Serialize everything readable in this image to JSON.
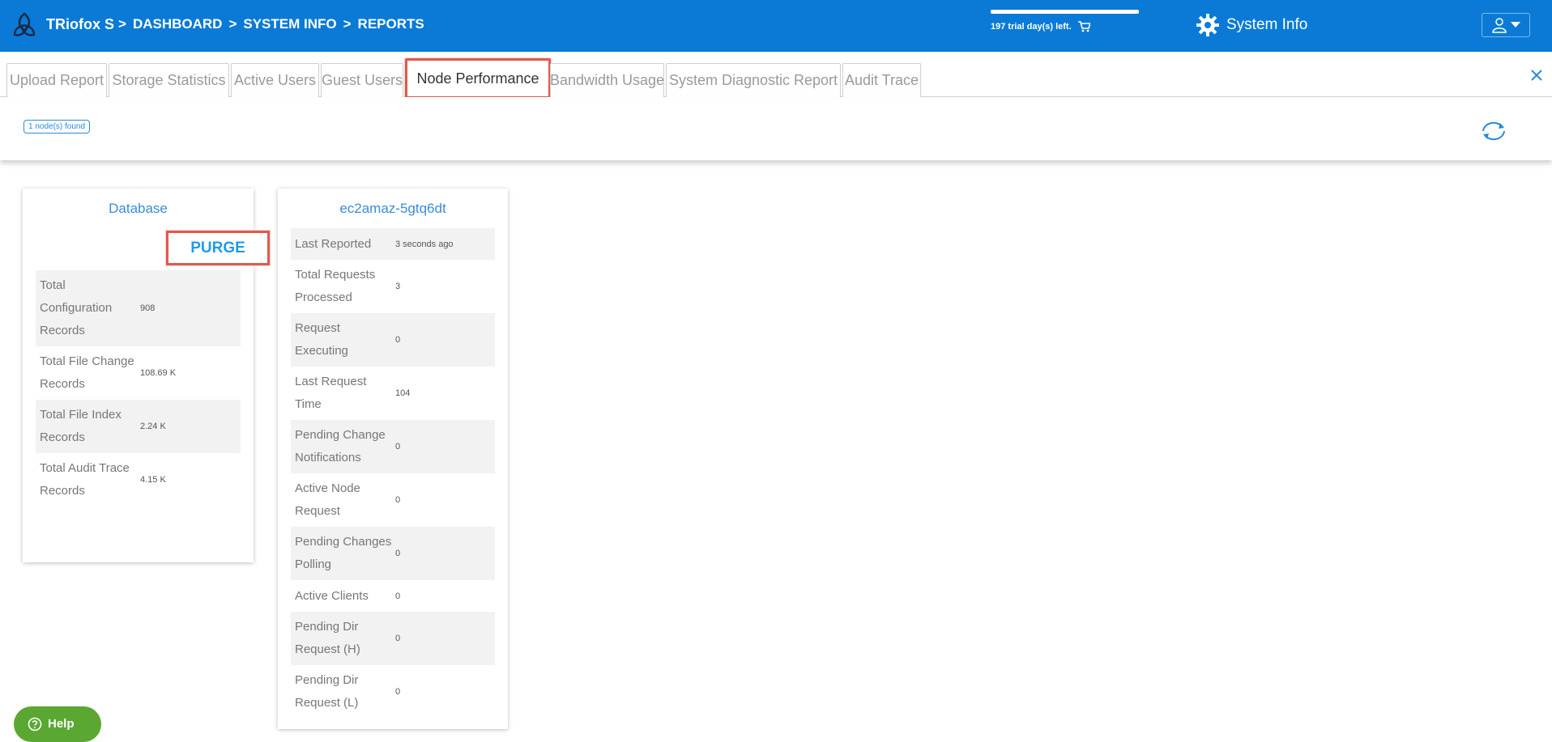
{
  "header": {
    "app_name": "TRiofox S",
    "breadcrumb": [
      ">",
      "DASHBOARD",
      ">",
      "SYSTEM INFO",
      ">",
      "REPORTS"
    ],
    "trial_text": "197 trial day(s) left.",
    "system_info_label": "System Info",
    "colors": {
      "header_bg": "#0a7ad6"
    }
  },
  "tabs": [
    {
      "label": "Upload Report",
      "active": false
    },
    {
      "label": "Storage Statistics",
      "active": false
    },
    {
      "label": "Active Users",
      "active": false
    },
    {
      "label": "Guest Users",
      "active": false
    },
    {
      "label": "Node Performance",
      "active": true
    },
    {
      "label": "Bandwidth Usage",
      "active": false
    },
    {
      "label": "System Diagnostic Report",
      "active": false
    },
    {
      "label": "Audit Trace",
      "active": false
    }
  ],
  "toolbar": {
    "nodes_found": "1 node(s) found"
  },
  "database_card": {
    "title": "Database",
    "purge_label": "PURGE",
    "rows": [
      {
        "label": "Total Configuration Records",
        "value": "908"
      },
      {
        "label": "Total File Change Records",
        "value": "108.69 K"
      },
      {
        "label": "Total File Index Records",
        "value": "2.24 K"
      },
      {
        "label": "Total Audit Trace Records",
        "value": "4.15 K"
      }
    ]
  },
  "node_card": {
    "title": "ec2amaz-5gtq6dt",
    "rows": [
      {
        "label": "Last Reported",
        "value": "3 seconds ago"
      },
      {
        "label": "Total Requests Processed",
        "value": "3"
      },
      {
        "label": "Request Executing",
        "value": "0"
      },
      {
        "label": "Last Request Time",
        "value": "104"
      },
      {
        "label": "Pending Change Notifications",
        "value": "0"
      },
      {
        "label": "Active Node Request",
        "value": "0"
      },
      {
        "label": "Pending Changes Polling",
        "value": "0"
      },
      {
        "label": "Active Clients",
        "value": "0"
      },
      {
        "label": "Pending Dir Request (H)",
        "value": "0"
      },
      {
        "label": "Pending Dir Request (L)",
        "value": "0"
      }
    ]
  },
  "help": {
    "label": "Help"
  }
}
